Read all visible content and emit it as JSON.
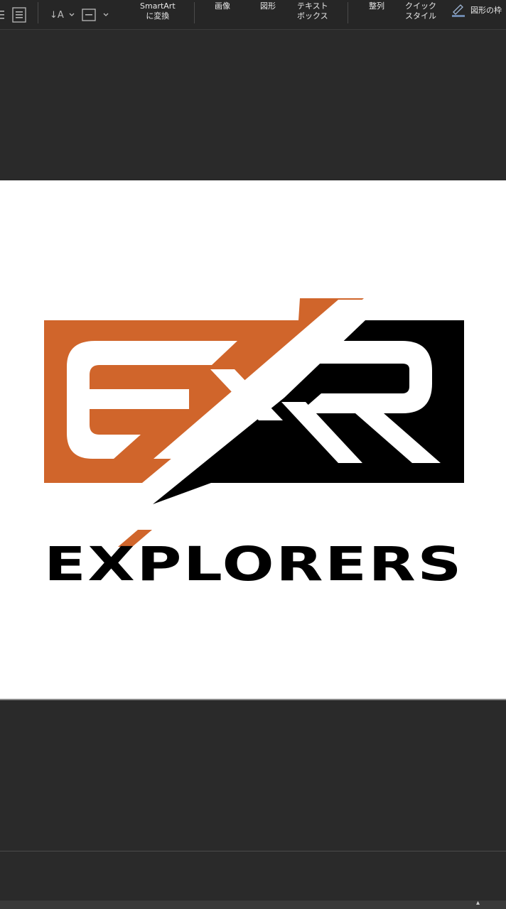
{
  "toolbar": {
    "smartart_line1": "SmartArt",
    "smartart_line2": "に変換",
    "image_label": "画像",
    "shape_label": "図形",
    "textbox_line1": "テキスト",
    "textbox_line2": "ボックス",
    "arrange_label": "整列",
    "quickstyle_line1": "クイック",
    "quickstyle_line2": "スタイル",
    "shape_outline_label": "図形の枠"
  },
  "slide": {
    "logo_monogram": "EXR",
    "logo_wordmark": "EXPLORERS"
  },
  "colors": {
    "brand_orange": "#D0652B",
    "brand_black": "#000000",
    "app_background": "#2A2A2A",
    "toolbar_background": "#262626"
  }
}
